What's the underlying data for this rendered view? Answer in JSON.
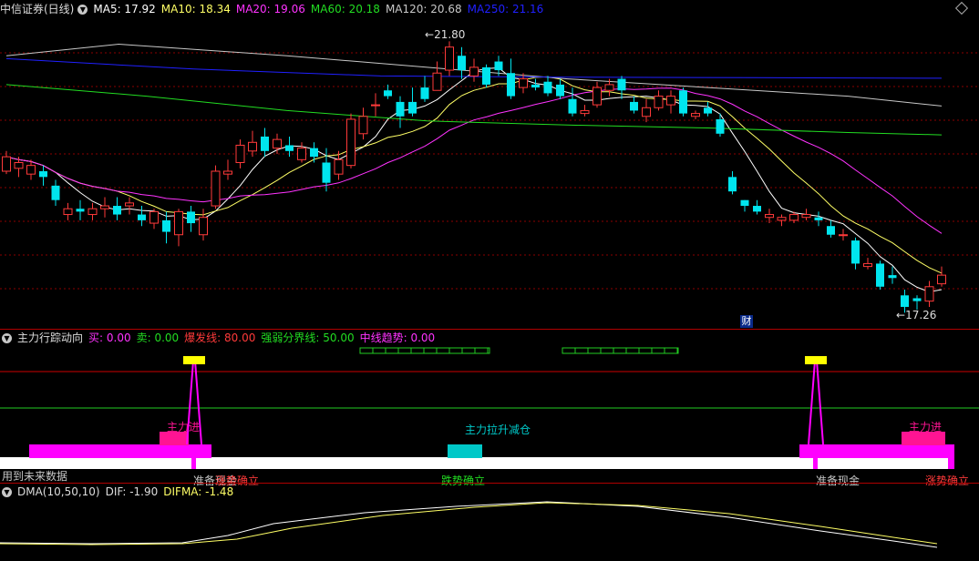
{
  "colors": {
    "up": "#ff3a3a",
    "down": "#00e5ee",
    "ma5": "#ffffff",
    "ma10": "#ffff66",
    "ma20": "#ff33ff",
    "ma60": "#22dd22",
    "ma120": "#c8c8c8",
    "ma250": "#2020ff",
    "grid": "#8b0000",
    "magenta": "#ff00ff",
    "pink": "#ff1493",
    "yellow": "#ffff00",
    "cyan": "#00c8c8",
    "green": "#22cc22"
  },
  "main_header": {
    "title": "中信证券(日线)",
    "ma5": "MA5: 17.92",
    "ma10": "MA10: 18.34",
    "ma20": "MA20: 19.06",
    "ma60": "MA60: 20.18",
    "ma120": "MA120: 20.68",
    "ma250": "MA250: 21.16"
  },
  "main_annotations": {
    "high": "21.80",
    "low": "17.26",
    "finance_tag": "财"
  },
  "indicator_header": {
    "title": "主力行踪动向",
    "buy": "买: 0.00",
    "sell": "卖: 0.00",
    "burst": "爆发线: 80.00",
    "divide": "强弱分界线: 50.00",
    "trend": "中线趋势: 0.00"
  },
  "indicator_labels": {
    "main_in_1": "主力进",
    "main_in_2": "主力进",
    "middle": "主力拉升减仓",
    "future_warning": "用到未来数据",
    "bottom_1": "准备现金",
    "bottom_1b": "涨势确立",
    "bottom_2": "跌势确立",
    "bottom_3": "准备现金",
    "bottom_4": "涨势确立"
  },
  "dma_header": {
    "title": "DMA(10,50,10)",
    "dif": "DIF: -1.90",
    "difma": "DIFMA: -1.48"
  },
  "chart_data": {
    "type": "candlestick",
    "price_axis": [
      16.9,
      22.2
    ],
    "candles": [
      [
        19.55,
        19.8,
        19.9,
        19.5
      ],
      [
        19.6,
        19.7,
        19.8,
        19.45
      ],
      [
        19.5,
        19.65,
        19.75,
        19.4
      ],
      [
        19.55,
        19.45,
        19.65,
        19.3
      ],
      [
        19.3,
        19.05,
        19.4,
        18.95
      ],
      [
        18.8,
        18.9,
        19.0,
        18.7
      ],
      [
        18.9,
        18.85,
        19.05,
        18.7
      ],
      [
        18.8,
        18.9,
        19.0,
        18.7
      ],
      [
        18.9,
        18.95,
        19.1,
        18.75
      ],
      [
        18.95,
        18.8,
        19.1,
        18.7
      ],
      [
        18.95,
        19.0,
        19.1,
        18.8
      ],
      [
        18.8,
        18.7,
        18.95,
        18.6
      ],
      [
        18.65,
        18.85,
        18.9,
        18.55
      ],
      [
        18.7,
        18.5,
        18.85,
        18.3
      ],
      [
        18.45,
        18.85,
        18.9,
        18.25
      ],
      [
        18.85,
        18.65,
        18.95,
        18.5
      ],
      [
        18.45,
        18.75,
        18.9,
        18.35
      ],
      [
        18.95,
        19.55,
        19.65,
        18.9
      ],
      [
        19.5,
        19.55,
        19.75,
        19.4
      ],
      [
        19.7,
        20.0,
        20.1,
        19.6
      ],
      [
        19.9,
        20.05,
        20.25,
        19.8
      ],
      [
        20.15,
        19.9,
        20.3,
        19.8
      ],
      [
        19.95,
        20.1,
        20.2,
        19.85
      ],
      [
        20.0,
        19.9,
        20.15,
        19.8
      ],
      [
        19.75,
        19.95,
        20.05,
        19.7
      ],
      [
        19.95,
        19.8,
        20.05,
        19.7
      ],
      [
        19.7,
        19.35,
        19.95,
        19.2
      ],
      [
        19.5,
        19.75,
        19.9,
        19.4
      ],
      [
        19.65,
        20.45,
        20.55,
        19.6
      ],
      [
        20.2,
        20.5,
        20.65,
        20.1
      ],
      [
        20.7,
        20.7,
        20.9,
        20.5
      ],
      [
        20.95,
        20.85,
        21.05,
        20.8
      ],
      [
        20.75,
        20.5,
        20.85,
        20.3
      ],
      [
        20.75,
        20.55,
        21.0,
        20.5
      ],
      [
        21.0,
        20.8,
        21.2,
        20.75
      ],
      [
        20.95,
        21.25,
        21.45,
        20.95
      ],
      [
        21.3,
        21.7,
        21.8,
        21.2
      ],
      [
        21.55,
        21.3,
        21.7,
        21.15
      ],
      [
        21.2,
        21.35,
        21.5,
        21.1
      ],
      [
        21.35,
        21.05,
        21.4,
        21.0
      ],
      [
        21.45,
        21.3,
        21.55,
        21.2
      ],
      [
        21.25,
        20.85,
        21.5,
        20.8
      ],
      [
        21.0,
        21.15,
        21.25,
        20.9
      ],
      [
        21.05,
        21.0,
        21.15,
        20.95
      ],
      [
        21.1,
        20.9,
        21.2,
        20.85
      ],
      [
        21.05,
        20.85,
        21.15,
        20.8
      ],
      [
        20.8,
        20.55,
        21.0,
        20.5
      ],
      [
        20.55,
        20.6,
        20.7,
        20.5
      ],
      [
        20.7,
        21.0,
        21.1,
        20.65
      ],
      [
        20.95,
        21.05,
        21.15,
        20.85
      ],
      [
        21.15,
        20.95,
        21.2,
        20.8
      ],
      [
        20.75,
        20.6,
        20.85,
        20.55
      ],
      [
        20.5,
        20.65,
        20.8,
        20.4
      ],
      [
        20.65,
        20.85,
        20.95,
        20.6
      ],
      [
        20.7,
        20.85,
        20.95,
        20.55
      ],
      [
        20.95,
        20.55,
        21.0,
        20.5
      ],
      [
        20.5,
        20.55,
        20.6,
        20.45
      ],
      [
        20.65,
        20.55,
        20.75,
        20.5
      ],
      [
        20.45,
        20.2,
        20.55,
        20.15
      ],
      [
        19.45,
        19.2,
        19.55,
        19.15
      ],
      [
        19.05,
        18.95,
        19.05,
        18.85
      ],
      [
        18.95,
        18.85,
        19.05,
        18.8
      ],
      [
        18.75,
        18.8,
        18.9,
        18.65
      ],
      [
        18.7,
        18.75,
        18.8,
        18.6
      ],
      [
        18.7,
        18.8,
        18.85,
        18.65
      ],
      [
        18.75,
        18.8,
        18.9,
        18.7
      ],
      [
        18.75,
        18.7,
        18.85,
        18.6
      ],
      [
        18.6,
        18.45,
        18.7,
        18.4
      ],
      [
        18.45,
        18.45,
        18.55,
        18.35
      ],
      [
        18.35,
        17.95,
        18.4,
        17.85
      ],
      [
        17.9,
        17.95,
        18.05,
        17.85
      ],
      [
        17.95,
        17.55,
        18.0,
        17.5
      ],
      [
        17.75,
        17.7,
        17.9,
        17.6
      ],
      [
        17.4,
        17.2,
        17.5,
        17.1
      ],
      [
        17.35,
        17.3,
        17.4,
        17.15
      ],
      [
        17.3,
        17.55,
        17.65,
        17.2
      ],
      [
        17.6,
        17.75,
        17.9,
        17.55
      ]
    ]
  }
}
